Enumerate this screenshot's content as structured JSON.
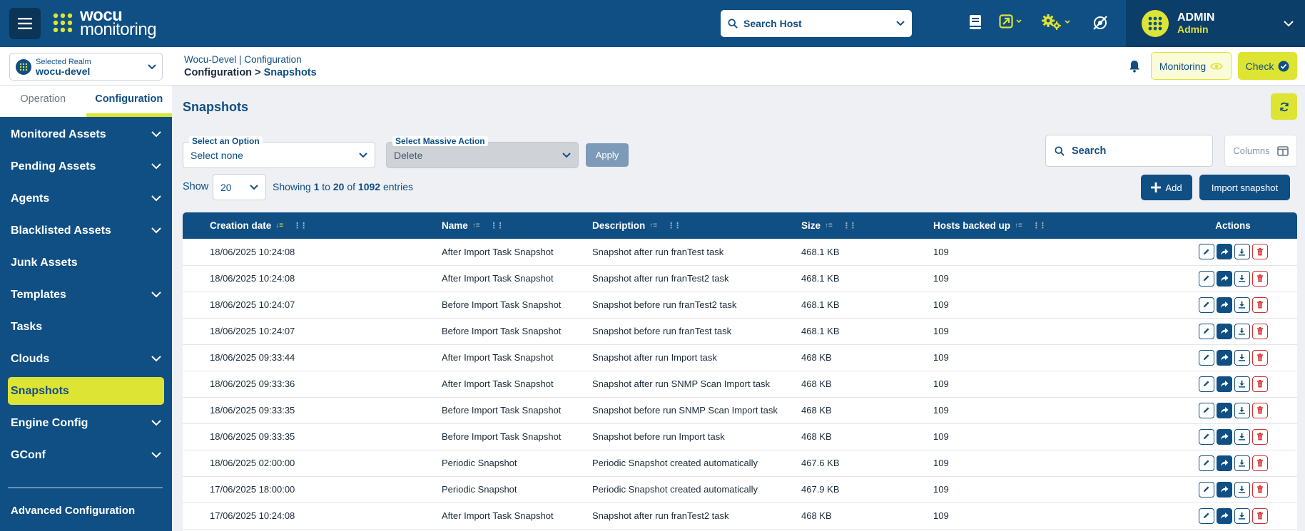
{
  "brand": {
    "line1": "wocu",
    "line2": "monitoring"
  },
  "topbar": {
    "host_search": "Search Host",
    "user": {
      "name": "ADMIN",
      "role": "Admin"
    }
  },
  "realm": {
    "label": "Selected Realm",
    "value": "wocu-devel"
  },
  "breadcrumb": {
    "top_realm": "Wocu-Devel",
    "top_separator": "|",
    "top_section": "Configuration",
    "bottom_section": "Configuration",
    "arrow": ">",
    "bottom_page": "Snapshots"
  },
  "header_buttons": {
    "monitoring": "Monitoring",
    "check": "Check"
  },
  "sidebar": {
    "tabs": [
      {
        "label": "Operation",
        "active": false
      },
      {
        "label": "Configuration",
        "active": true
      }
    ],
    "items": [
      {
        "label": "Monitored Assets",
        "expandable": true
      },
      {
        "label": "Pending Assets",
        "expandable": true
      },
      {
        "label": "Agents",
        "expandable": true
      },
      {
        "label": "Blacklisted Assets",
        "expandable": true
      },
      {
        "label": "Junk Assets",
        "expandable": false
      },
      {
        "label": "Templates",
        "expandable": true
      },
      {
        "label": "Tasks",
        "expandable": false
      },
      {
        "label": "Clouds",
        "expandable": true
      },
      {
        "label": "Snapshots",
        "expandable": false,
        "active": true
      },
      {
        "label": "Engine Config",
        "expandable": true
      },
      {
        "label": "GConf",
        "expandable": true
      }
    ],
    "advanced": "Advanced Configuration"
  },
  "main": {
    "title": "Snapshots",
    "select_option": {
      "label": "Select an Option",
      "value": "Select none"
    },
    "select_massive": {
      "label": "Select Massive Action",
      "value": "Delete"
    },
    "apply": "Apply",
    "search_placeholder": "Search",
    "columns_button": "Columns",
    "show_label": "Show",
    "page_size": "20",
    "showing": {
      "prefix": "Showing",
      "from": "1",
      "to_word": "to",
      "to": "20",
      "of_word": "of",
      "total": "1092",
      "suffix": "entries"
    },
    "add_button": "Add",
    "import_button": "Import snapshot"
  },
  "table": {
    "columns": [
      "Creation date",
      "Name",
      "Description",
      "Size",
      "Hosts backed up",
      "Actions"
    ],
    "rows": [
      [
        "18/06/2025 10:24:08",
        "After Import Task Snapshot",
        "Snapshot after run franTest task",
        "468.1 KB",
        "109"
      ],
      [
        "18/06/2025 10:24:08",
        "After Import Task Snapshot",
        "Snapshot after run franTest2 task",
        "468.1 KB",
        "109"
      ],
      [
        "18/06/2025 10:24:07",
        "Before Import Task Snapshot",
        "Snapshot before run franTest2 task",
        "468.1 KB",
        "109"
      ],
      [
        "18/06/2025 10:24:07",
        "Before Import Task Snapshot",
        "Snapshot before run franTest task",
        "468.1 KB",
        "109"
      ],
      [
        "18/06/2025 09:33:44",
        "After Import Task Snapshot",
        "Snapshot after run Import task",
        "468 KB",
        "109"
      ],
      [
        "18/06/2025 09:33:36",
        "After Import Task Snapshot",
        "Snapshot after run SNMP Scan Import task",
        "468 KB",
        "109"
      ],
      [
        "18/06/2025 09:33:35",
        "Before Import Task Snapshot",
        "Snapshot before run SNMP Scan Import task",
        "468 KB",
        "109"
      ],
      [
        "18/06/2025 09:33:35",
        "Before Import Task Snapshot",
        "Snapshot before run Import task",
        "468 KB",
        "109"
      ],
      [
        "18/06/2025 02:00:00",
        "Periodic Snapshot",
        "Periodic Snapshot created automatically",
        "467.6 KB",
        "109"
      ],
      [
        "17/06/2025 18:00:00",
        "Periodic Snapshot",
        "Periodic Snapshot created automatically",
        "467.9 KB",
        "109"
      ],
      [
        "17/06/2025 10:24:08",
        "After Import Task Snapshot",
        "Snapshot after run franTest2 task",
        "468 KB",
        "109"
      ]
    ]
  },
  "colors": {
    "primary": "#0f4f84",
    "accent": "#dde433",
    "danger": "#d62d2d"
  }
}
